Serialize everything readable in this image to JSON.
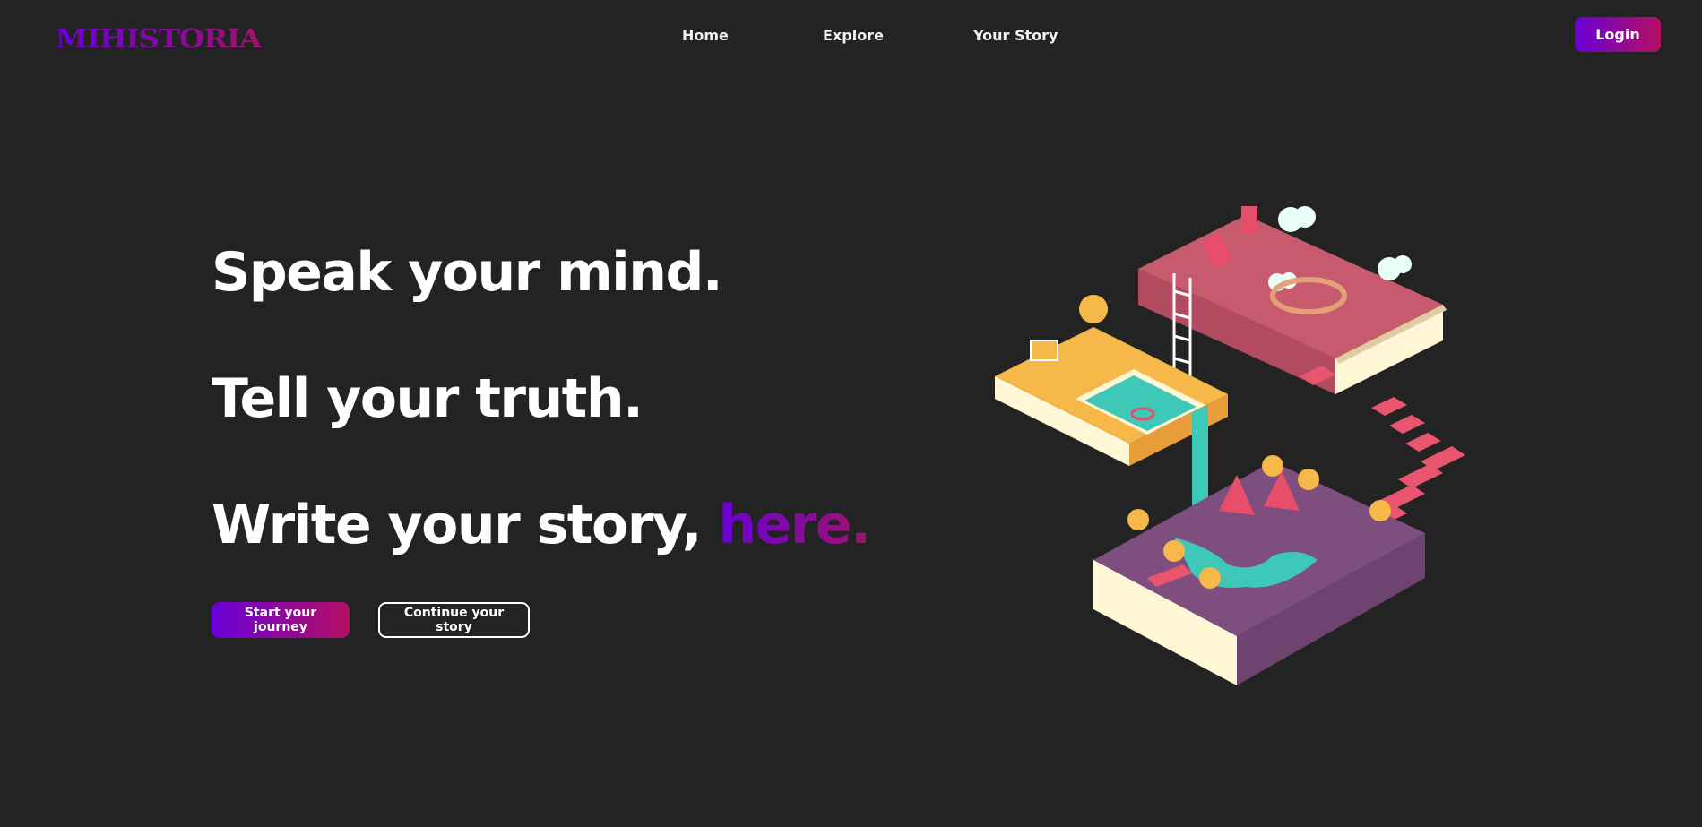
{
  "brand": {
    "name": "MIHISTORIA"
  },
  "nav": {
    "items": [
      "Home",
      "Explore",
      "Your Story"
    ],
    "login_label": "Login"
  },
  "hero": {
    "line1": "Speak your mind.",
    "line2": "Tell your truth.",
    "line3_prefix": "Write your story, ",
    "line3_highlight": "here.",
    "primary_cta": "Start your journey",
    "secondary_cta": "Continue your story"
  },
  "illustration": {
    "icon": "isometric-books-illustration"
  },
  "colors": {
    "background": "#232323",
    "accent_start": "#6a00d8",
    "accent_end": "#b50f63",
    "text": "#ffffff"
  }
}
